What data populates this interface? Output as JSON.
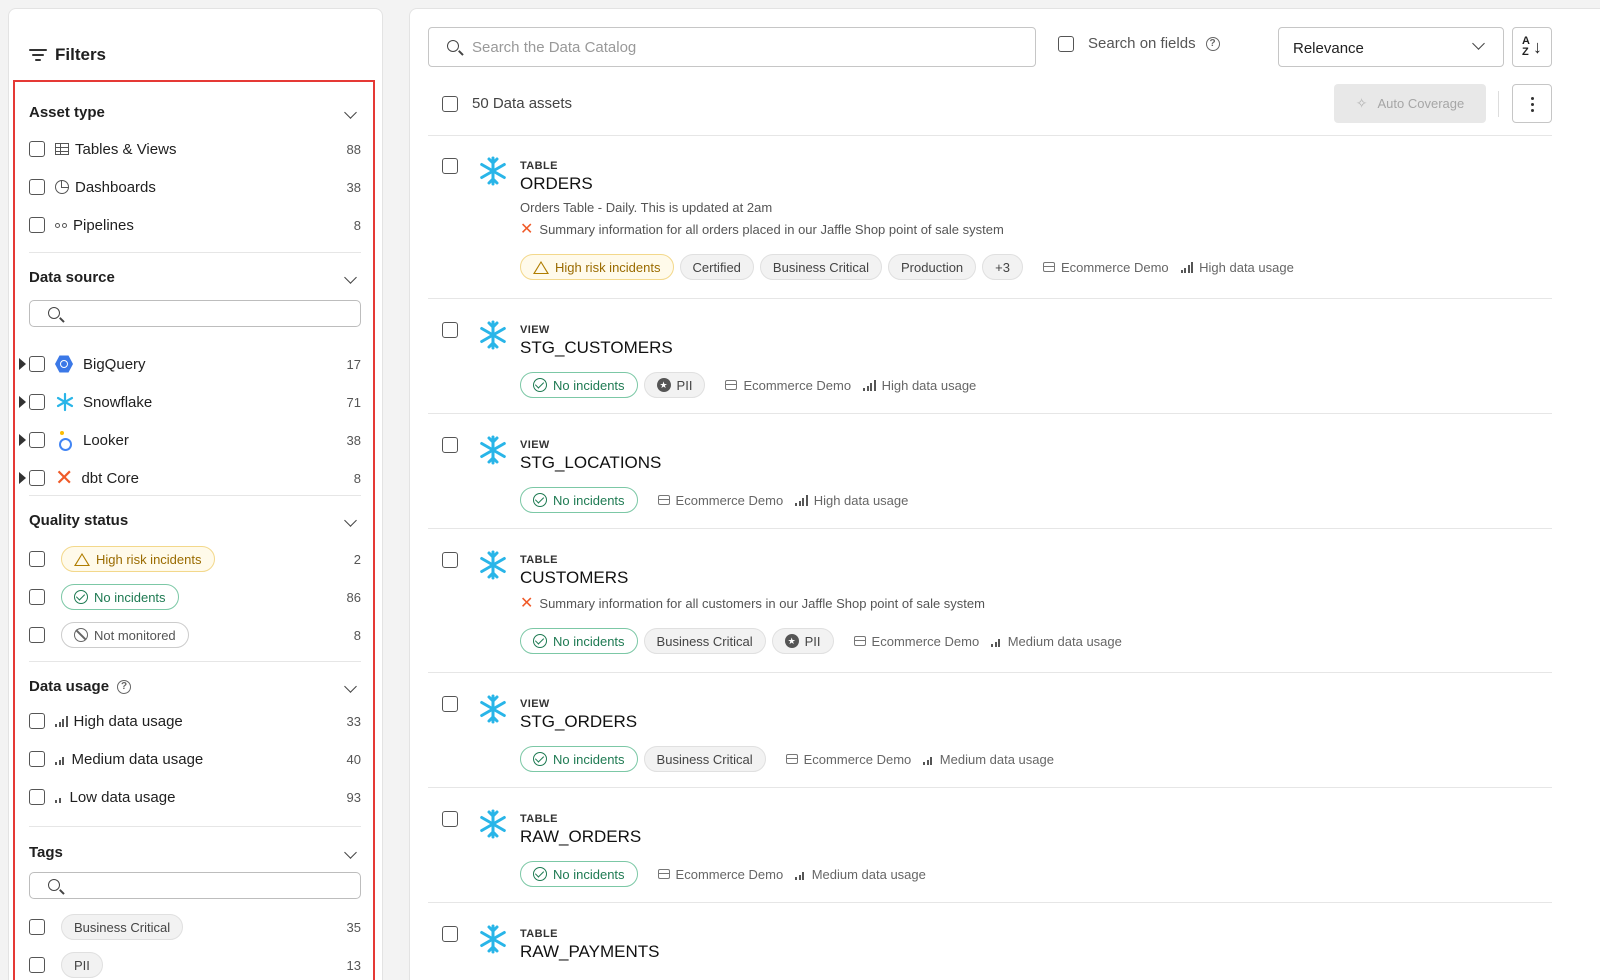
{
  "sidebar": {
    "title": "Filters",
    "asset_type": {
      "title": "Asset type",
      "items": [
        {
          "label": "Tables & Views",
          "count": "88",
          "icon": "table-icon"
        },
        {
          "label": "Dashboards",
          "count": "38",
          "icon": "dashboard-icon"
        },
        {
          "label": "Pipelines",
          "count": "8",
          "icon": "pipeline-icon"
        }
      ]
    },
    "data_source": {
      "title": "Data source",
      "search_placeholder": "",
      "items": [
        {
          "label": "BigQuery",
          "count": "17",
          "icon": "bigquery-icon"
        },
        {
          "label": "Snowflake",
          "count": "71",
          "icon": "snowflake-icon"
        },
        {
          "label": "Looker",
          "count": "38",
          "icon": "looker-icon"
        },
        {
          "label": "dbt Core",
          "count": "8",
          "icon": "dbt-icon"
        }
      ]
    },
    "quality_status": {
      "title": "Quality status",
      "items": [
        {
          "label": "High risk incidents",
          "count": "2",
          "style": "risk"
        },
        {
          "label": "No incidents",
          "count": "86",
          "style": "ok"
        },
        {
          "label": "Not monitored",
          "count": "8",
          "style": "nm"
        }
      ]
    },
    "data_usage": {
      "title": "Data usage",
      "help": "?",
      "items": [
        {
          "label": "High data usage",
          "count": "33",
          "level": 4
        },
        {
          "label": "Medium data usage",
          "count": "40",
          "level": 3
        },
        {
          "label": "Low data usage",
          "count": "93",
          "level": 2
        }
      ]
    },
    "tags": {
      "title": "Tags",
      "search_placeholder": "",
      "items": [
        {
          "label": "Business Critical",
          "count": "35"
        },
        {
          "label": "PII",
          "count": "13"
        }
      ]
    }
  },
  "main": {
    "search_placeholder": "Search the Data Catalog",
    "search_on_fields": "Search on fields",
    "sort_value": "Relevance",
    "sort_icon_top": "AZ",
    "assets_count": "50 Data assets",
    "auto_coverage": "Auto Coverage",
    "items": [
      {
        "type": "TABLE",
        "name": "ORDERS",
        "desc": "Orders Table - Daily. This is updated at 2am",
        "desc2": "Summary information for all orders placed in our Jaffle Shop point of sale system",
        "tags": [
          {
            "label": "High risk incidents",
            "style": "risk"
          },
          {
            "label": "Certified",
            "style": "gray"
          },
          {
            "label": "Business Critical",
            "style": "gray"
          },
          {
            "label": "Production",
            "style": "gray"
          },
          {
            "label": "+3",
            "style": "gray"
          }
        ],
        "domain": "Ecommerce Demo",
        "usage": "High data usage"
      },
      {
        "type": "VIEW",
        "name": "STG_CUSTOMERS",
        "tags": [
          {
            "label": "No incidents",
            "style": "ok"
          },
          {
            "label": "PII",
            "style": "pii"
          }
        ],
        "domain": "Ecommerce Demo",
        "usage": "High data usage"
      },
      {
        "type": "VIEW",
        "name": "STG_LOCATIONS",
        "tags": [
          {
            "label": "No incidents",
            "style": "ok"
          }
        ],
        "domain": "Ecommerce Demo",
        "usage": "High data usage"
      },
      {
        "type": "TABLE",
        "name": "CUSTOMERS",
        "desc2": "Summary information for all customers in our Jaffle Shop point of sale system",
        "tags": [
          {
            "label": "No incidents",
            "style": "ok"
          },
          {
            "label": "Business Critical",
            "style": "gray"
          },
          {
            "label": "PII",
            "style": "pii"
          }
        ],
        "domain": "Ecommerce Demo",
        "usage": "Medium data usage"
      },
      {
        "type": "VIEW",
        "name": "STG_ORDERS",
        "tags": [
          {
            "label": "No incidents",
            "style": "ok"
          },
          {
            "label": "Business Critical",
            "style": "gray"
          }
        ],
        "domain": "Ecommerce Demo",
        "usage": "Medium data usage"
      },
      {
        "type": "TABLE",
        "name": "RAW_ORDERS",
        "tags": [
          {
            "label": "No incidents",
            "style": "ok"
          }
        ],
        "domain": "Ecommerce Demo",
        "usage": "Medium data usage"
      },
      {
        "type": "TABLE",
        "name": "RAW_PAYMENTS",
        "tags": []
      }
    ]
  },
  "colors": {
    "accent_red": "#e53935",
    "snowflake": "#29b5e8",
    "ok_green": "#1e7a52",
    "risk_amber": "#9a6b00"
  }
}
